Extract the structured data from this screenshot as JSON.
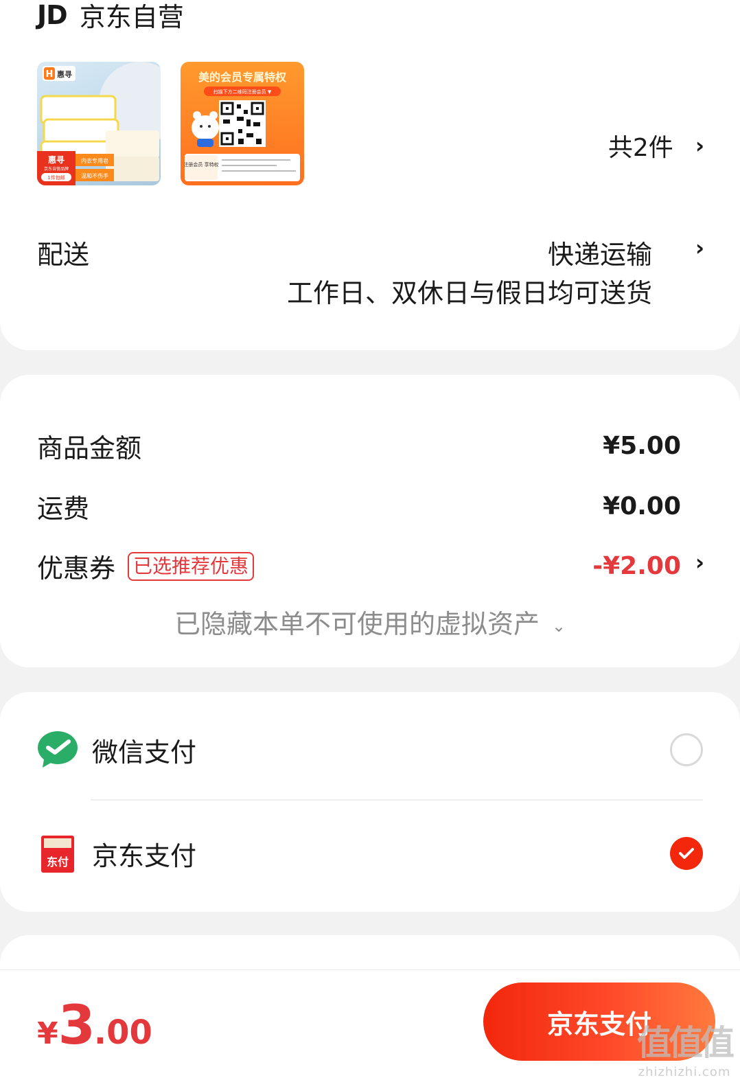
{
  "shop": {
    "logo_text": "JD",
    "name": "京东自营",
    "items": [
      {
        "thumb_title": "惠寻",
        "badge_top": "惠寻",
        "badge_sub": "京东自营品牌",
        "badge_tag": "1件包邮",
        "tag1": "内衣专用皂",
        "tag2": "温和不伤手"
      },
      {
        "thumb_title": "美的会员专属特权",
        "thumb_subtitle": "扫描下方二维码注册会员 ▼",
        "side_title": "注册会员\n享特权"
      }
    ],
    "item_count": "共2件"
  },
  "delivery": {
    "label": "配送",
    "method": "快递运输",
    "note": "工作日、双休日与假日均可送货"
  },
  "price": {
    "goods_label": "商品金额",
    "goods_value": "¥5.00",
    "shipping_label": "运费",
    "shipping_value": "¥0.00",
    "coupon_label": "优惠券",
    "coupon_tag": "已选推荐优惠",
    "coupon_value": "-¥2.00",
    "hidden_assets": "已隐藏本单不可使用的虚拟资产"
  },
  "payment": {
    "options": [
      {
        "label": "微信支付",
        "icon": "wechat-pay-icon",
        "selected": false
      },
      {
        "label": "京东支付",
        "icon": "jd-pay-icon",
        "selected": true,
        "icon_text": "东付"
      }
    ]
  },
  "footer": {
    "currency": "¥",
    "total_int": "3",
    "total_dec": ".00",
    "pay_button": "京东支付"
  },
  "watermark": {
    "big": "值值值",
    "small": "zhizhizhi.com"
  },
  "colors": {
    "accent": "#f2270c",
    "coupon_red": "#e4393c",
    "wechat_green": "#2aae67"
  }
}
